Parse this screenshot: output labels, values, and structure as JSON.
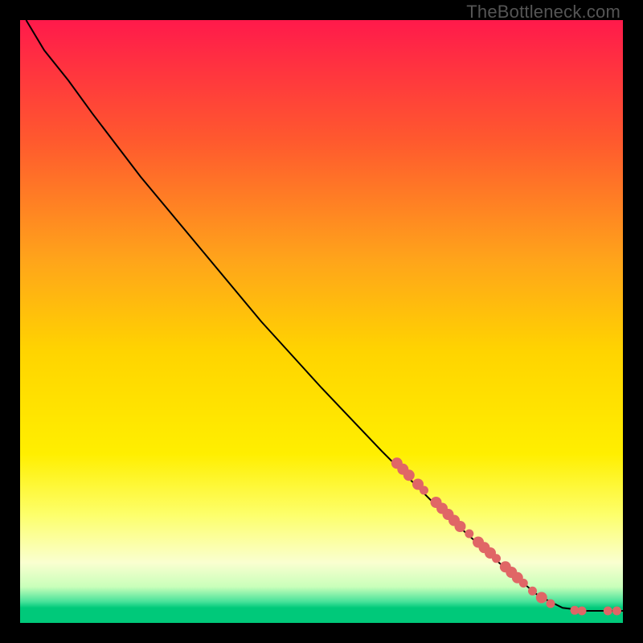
{
  "watermark": "TheBottleneck.com",
  "chart_data": {
    "type": "line",
    "title": "",
    "xlabel": "",
    "ylabel": "",
    "xlim": [
      0,
      100
    ],
    "ylim": [
      0,
      100
    ],
    "background_gradient": [
      {
        "stop": 0.0,
        "color": "#ff1a4b"
      },
      {
        "stop": 0.2,
        "color": "#ff592e"
      },
      {
        "stop": 0.4,
        "color": "#ffa51a"
      },
      {
        "stop": 0.55,
        "color": "#ffd400"
      },
      {
        "stop": 0.72,
        "color": "#ffef00"
      },
      {
        "stop": 0.82,
        "color": "#fdff6a"
      },
      {
        "stop": 0.9,
        "color": "#faffd0"
      },
      {
        "stop": 0.94,
        "color": "#c9ffba"
      },
      {
        "stop": 0.965,
        "color": "#46e29a"
      },
      {
        "stop": 0.975,
        "color": "#00c97a"
      },
      {
        "stop": 1.0,
        "color": "#00c97a"
      }
    ],
    "series": [
      {
        "name": "curve",
        "stroke": "#000000",
        "points": [
          {
            "x": 1,
            "y": 100
          },
          {
            "x": 4,
            "y": 95
          },
          {
            "x": 8,
            "y": 90
          },
          {
            "x": 12,
            "y": 84.5
          },
          {
            "x": 20,
            "y": 74
          },
          {
            "x": 30,
            "y": 62
          },
          {
            "x": 40,
            "y": 50
          },
          {
            "x": 50,
            "y": 39
          },
          {
            "x": 60,
            "y": 28.5
          },
          {
            "x": 70,
            "y": 18.5
          },
          {
            "x": 80,
            "y": 9.5
          },
          {
            "x": 86,
            "y": 4.5
          },
          {
            "x": 90,
            "y": 2.5
          },
          {
            "x": 94,
            "y": 2.0
          },
          {
            "x": 97,
            "y": 2.0
          },
          {
            "x": 100,
            "y": 2.0
          }
        ]
      }
    ],
    "markers": {
      "color": "#e06666",
      "radius_small": 5.5,
      "radius_large": 7,
      "positions": [
        {
          "x": 62.5,
          "y": 26.5,
          "r": "large"
        },
        {
          "x": 63.5,
          "y": 25.5,
          "r": "large"
        },
        {
          "x": 64.5,
          "y": 24.5,
          "r": "large"
        },
        {
          "x": 66.0,
          "y": 23.0,
          "r": "large"
        },
        {
          "x": 67.0,
          "y": 22.0,
          "r": "small"
        },
        {
          "x": 69.0,
          "y": 20.0,
          "r": "large"
        },
        {
          "x": 70.0,
          "y": 19.0,
          "r": "large"
        },
        {
          "x": 71.0,
          "y": 18.0,
          "r": "large"
        },
        {
          "x": 72.0,
          "y": 17.0,
          "r": "large"
        },
        {
          "x": 73.0,
          "y": 16.0,
          "r": "large"
        },
        {
          "x": 74.5,
          "y": 14.8,
          "r": "small"
        },
        {
          "x": 76.0,
          "y": 13.4,
          "r": "large"
        },
        {
          "x": 77.0,
          "y": 12.5,
          "r": "large"
        },
        {
          "x": 78.0,
          "y": 11.6,
          "r": "large"
        },
        {
          "x": 79.0,
          "y": 10.7,
          "r": "small"
        },
        {
          "x": 80.5,
          "y": 9.3,
          "r": "large"
        },
        {
          "x": 81.5,
          "y": 8.4,
          "r": "large"
        },
        {
          "x": 82.5,
          "y": 7.5,
          "r": "large"
        },
        {
          "x": 83.5,
          "y": 6.6,
          "r": "small"
        },
        {
          "x": 85.0,
          "y": 5.3,
          "r": "small"
        },
        {
          "x": 86.5,
          "y": 4.2,
          "r": "large"
        },
        {
          "x": 88.0,
          "y": 3.2,
          "r": "small"
        },
        {
          "x": 92.0,
          "y": 2.1,
          "r": "small"
        },
        {
          "x": 93.2,
          "y": 2.0,
          "r": "small"
        },
        {
          "x": 97.5,
          "y": 2.0,
          "r": "small"
        },
        {
          "x": 99.0,
          "y": 2.0,
          "r": "small"
        }
      ]
    }
  }
}
